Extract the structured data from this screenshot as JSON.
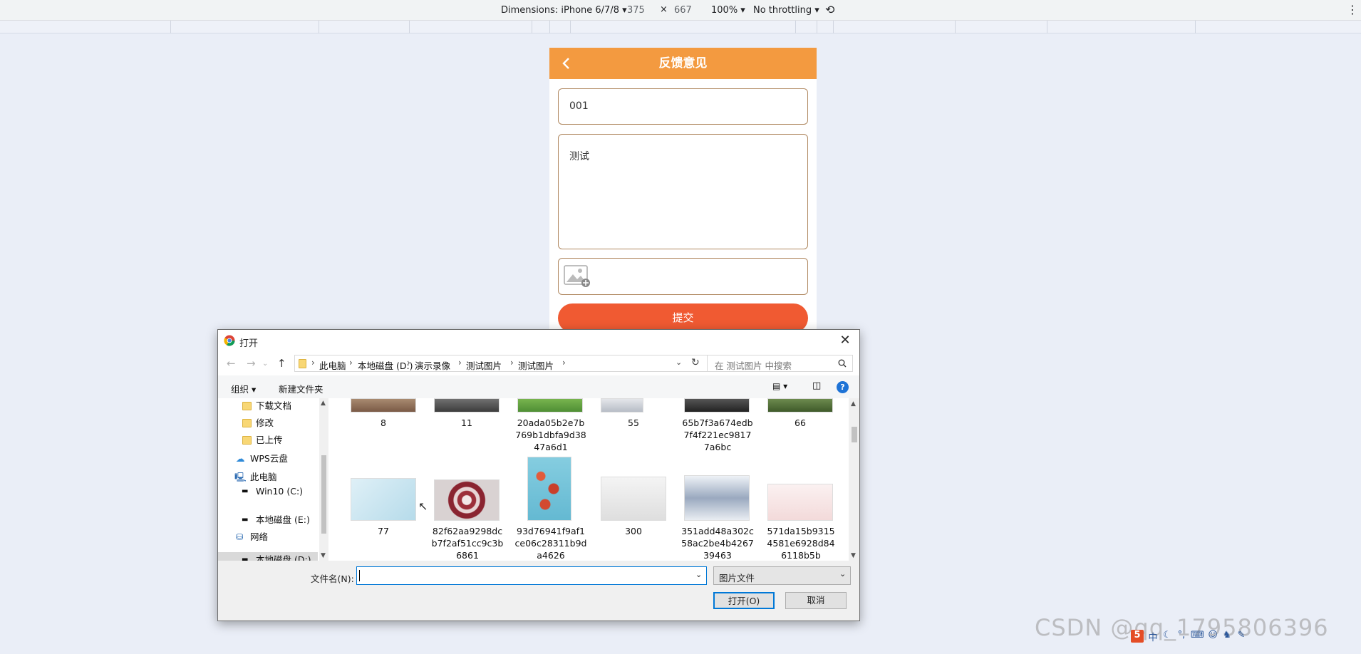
{
  "devtools": {
    "dimensions_label": "Dimensions: iPhone 6/7/8",
    "width": "375",
    "times": "×",
    "height": "667",
    "zoom": "100%",
    "throttle": "No throttling"
  },
  "app": {
    "title": "反馈意见",
    "field1_value": "001",
    "textarea_value": "测试",
    "submit_label": "提交"
  },
  "dialog": {
    "title": "打开",
    "close": "✕",
    "breadcrumb": [
      "此电脑",
      "本地磁盘 (D:)",
      "演示录像",
      "测试图片",
      "测试图片"
    ],
    "search_placeholder": "在 测试图片 中搜索",
    "organize_label": "组织 ▾",
    "new_folder_label": "新建文件夹",
    "help": "?",
    "tree": [
      {
        "label": "下载文档",
        "icon": "folder-icon"
      },
      {
        "label": "修改",
        "icon": "folder-icon"
      },
      {
        "label": "已上传",
        "icon": "folder-icon"
      },
      {
        "label": "WPS云盘",
        "icon": "cloud-icon"
      },
      {
        "label": "此电脑",
        "icon": "computer-icon"
      },
      {
        "label": "Win10 (C:)",
        "icon": "drive-icon"
      },
      {
        "label": "本地磁盘 (D:)",
        "icon": "drive-icon"
      },
      {
        "label": "本地磁盘 (E:)",
        "icon": "drive-icon"
      },
      {
        "label": "网络",
        "icon": "network-icon"
      }
    ],
    "files_row1": [
      "8",
      "11",
      "20ada05b2e7b769b1dbfa9d3847a6d1",
      "55",
      "65b7f3a674edb7f4f221ec98177a6bc",
      "66"
    ],
    "files_row2": [
      "77",
      "82f62aa9298dcb7f2af51cc9c3b6861",
      "93d76941f9af1ce06c28311b9da4626",
      "300",
      "351add48a302c58ac2be4b426739463",
      "571da15b93154581e6928d846118b5b"
    ],
    "filename_label": "文件名(N):",
    "filename_value": "",
    "filetype_value": "图片文件",
    "open_label": "打开(O)",
    "cancel_label": "取消"
  },
  "watermark": "CSDN @qq_1795806396"
}
